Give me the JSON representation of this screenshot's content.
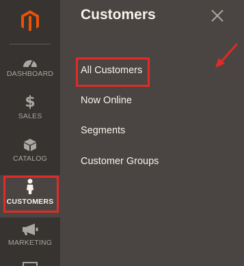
{
  "sidebar": {
    "logo_icon": "magento-logo-icon",
    "items": [
      {
        "label": "DASHBOARD",
        "icon": "speedometer-icon",
        "active": false
      },
      {
        "label": "SALES",
        "icon": "dollar-icon",
        "active": false
      },
      {
        "label": "CATALOG",
        "icon": "box-icon",
        "active": false
      },
      {
        "label": "CUSTOMERS",
        "icon": "person-icon",
        "active": true
      },
      {
        "label": "MARKETING",
        "icon": "megaphone-icon",
        "active": false
      }
    ]
  },
  "flyout": {
    "title": "Customers",
    "close_icon": "close-icon",
    "links": [
      {
        "label": "All Customers",
        "highlighted": true
      },
      {
        "label": "Now Online",
        "highlighted": false
      },
      {
        "label": "Segments",
        "highlighted": false
      },
      {
        "label": "Customer Groups",
        "highlighted": false
      }
    ]
  },
  "annotations": {
    "highlight_color": "#e02b27",
    "arrow_icon": "red-arrow-icon"
  },
  "colors": {
    "sidebar_bg": "#373330",
    "flyout_bg": "#4a4542",
    "logo_orange": "#eb5202",
    "text_light": "#f7f3eb",
    "text_muted": "#aaa6a0"
  }
}
